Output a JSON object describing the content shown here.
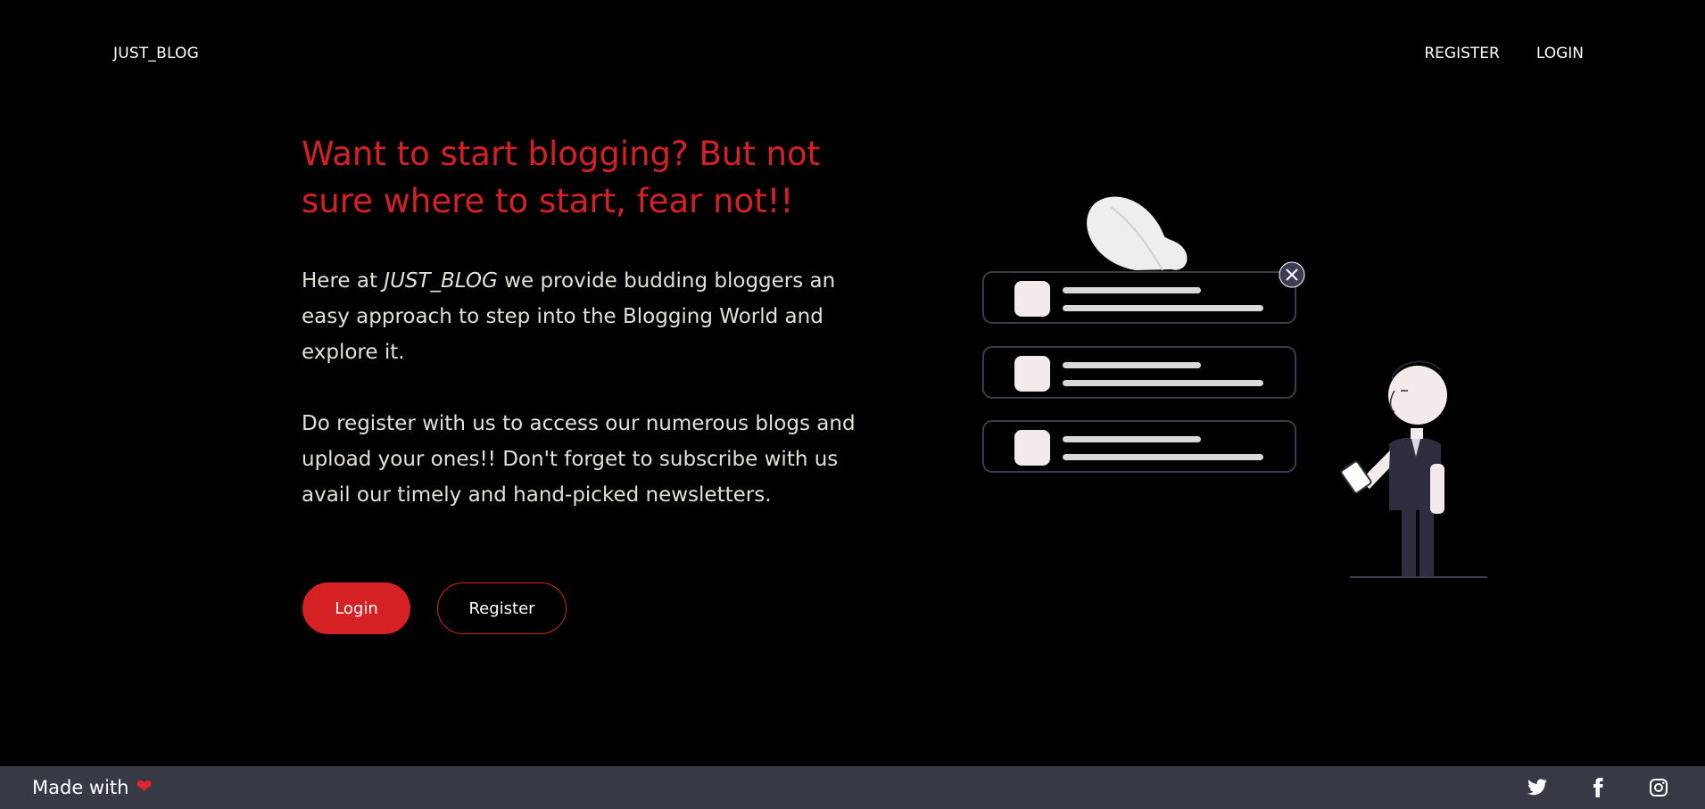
{
  "nav": {
    "brand": "JUST_BLOG",
    "links": [
      "REGISTER",
      "LOGIN"
    ]
  },
  "hero": {
    "title": "Want to start blogging? But not sure where to start, fear not!!",
    "para1_prefix": "Here at ",
    "para1_brand": "JUST_BLOG",
    "para1_suffix": " we provide budding bloggers an easy approach to step into the Blogging World and explore it.",
    "para2": "Do register with us to access our numerous blogs and upload your ones!! Don't forget to subscribe with us avail our timely and hand-picked newsletters.",
    "login_label": "Login",
    "register_label": "Register"
  },
  "footer": {
    "made_with": "Made with",
    "heart_icon": "heart-icon",
    "social_icons": [
      "twitter-icon",
      "facebook-icon",
      "instagram-icon"
    ]
  },
  "colors": {
    "accent": "#d62124",
    "background": "#000000",
    "footer": "#373a44",
    "body_text": "#e4e0d8"
  }
}
